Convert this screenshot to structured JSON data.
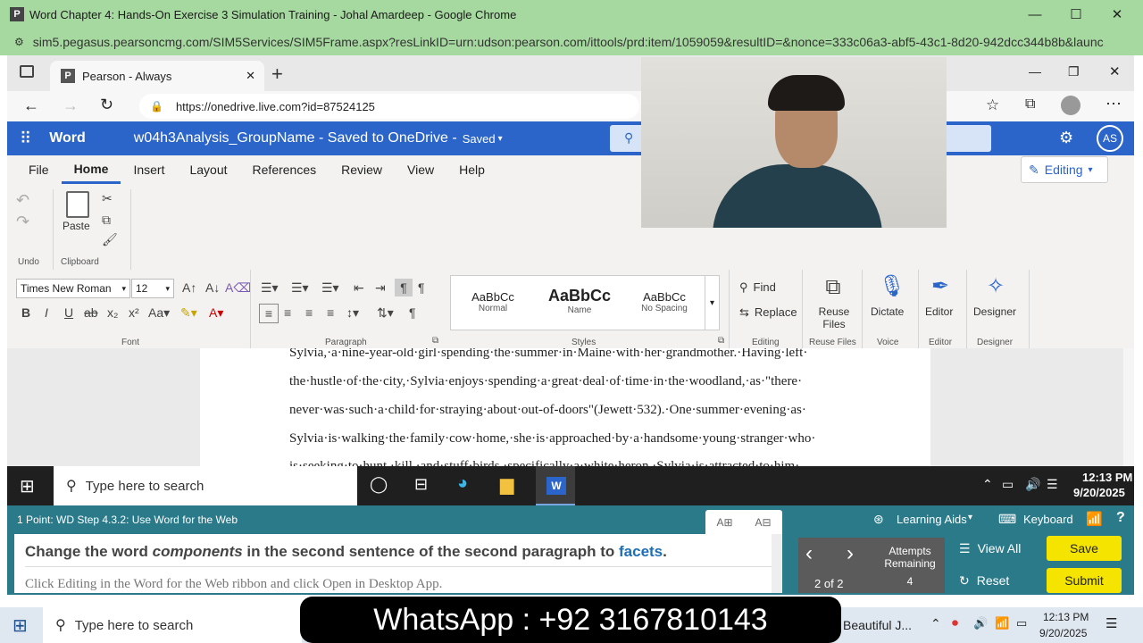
{
  "outer_window": {
    "title": "Word Chapter 4: Hands-On Exercise 3 Simulation Training - Johal Amardeep - Google Chrome",
    "url": "sim5.pegasus.pearsoncmg.com/SIM5Services/SIM5Frame.aspx?resLinkID=urn:udson:pearson.com/ittools/prd:item/1059059&resultID=&nonce=333c06a3-abf5-43c1-8d20-942dcc344b8b&launc..."
  },
  "inner_browser": {
    "tab_title": "Pearson - Always",
    "address": "https://onedrive.live.com?id=87524125"
  },
  "word": {
    "app_name": "Word",
    "doc_title": "w04h3Analysis_GroupName - Saved to OneDrive -",
    "saved_label": "Saved",
    "user_initials": "AS",
    "menu": [
      "File",
      "Home",
      "Insert",
      "Layout",
      "References",
      "Review",
      "View",
      "Help"
    ],
    "active_menu": "Home",
    "editing_label": "Editing",
    "groups": {
      "undo": "Undo",
      "clipboard": "Clipboard",
      "paste": "Paste",
      "font": "Font",
      "paragraph": "Paragraph",
      "styles": "Styles",
      "editing": "Editing",
      "reuse_files": "Reuse Files",
      "voice": "Voice",
      "editor": "Editor",
      "designer": "Designer"
    },
    "font_name": "Times New Roman",
    "font_size": "12",
    "styles": [
      {
        "sample": "AaBbCc",
        "name": "Normal"
      },
      {
        "sample": "AaBbCc",
        "name": "Name"
      },
      {
        "sample": "AaBbCc",
        "name": "No Spacing"
      }
    ],
    "find_label": "Find",
    "replace_label": "Replace",
    "reuse_label": "Reuse\nFiles",
    "dictate_label": "Dictate",
    "editor_label": "Editor",
    "designer_label": "Designer",
    "doc_lines": [
      "Sylvia,·a·nine-year-old·girl·spending·the·summer·in·Maine·with·her·grandmother.·Having·left·",
      "the·hustle·of·the·city,·Sylvia·enjoys·spending·a·great·deal·of·time·in·the·woodland,·as·\"there·",
      "never·was·such·a·child·for·straying·about·out-of-doors\"(Jewett·532).·One·summer·evening·as·",
      "Sylvia·is·walking·the·family·cow·home,·she·is·approached·by·a·handsome·young·stranger·who·",
      "is·seeking·to·hunt,·kill,·and·stuff·birds,·specifically·a·white·heron.·Sylvia·is·attracted·to·him·"
    ]
  },
  "taskbar_inner": {
    "search_placeholder": "Type here to search",
    "time": "12:13 PM",
    "date": "9/20/2025"
  },
  "sim": {
    "step": "1 Point: WD Step 4.3.2: Use Word for the Web",
    "learning_aids": "Learning Aids",
    "keyboard": "Keyboard",
    "instruction_pre": "Change the word ",
    "instruction_word": "components",
    "instruction_mid": " in the second sentence of the second paragraph to ",
    "instruction_target": "facets",
    "instruction_end": ".",
    "hint": "Click Editing in the Word for the Web ribbon and click Open in Desktop App.",
    "page_indicator": "2 of 2",
    "attempts_label": "Attempts Remaining",
    "attempts_value": "4",
    "view_all": "View All",
    "reset": "Reset",
    "save": "Save",
    "submit": "Submit"
  },
  "taskbar_outer": {
    "search_placeholder": "Type here to search",
    "app_label": "Beautiful J...",
    "time": "12:13 PM",
    "date": "9/20/2025"
  },
  "overlay": {
    "whatsapp": "WhatsApp : +92 3167810143"
  },
  "colors": {
    "outer_chrome": "#a6d99f",
    "word_blue": "#2b65c9",
    "sim_teal": "#2a7a8a",
    "button_yellow": "#f4e400"
  }
}
